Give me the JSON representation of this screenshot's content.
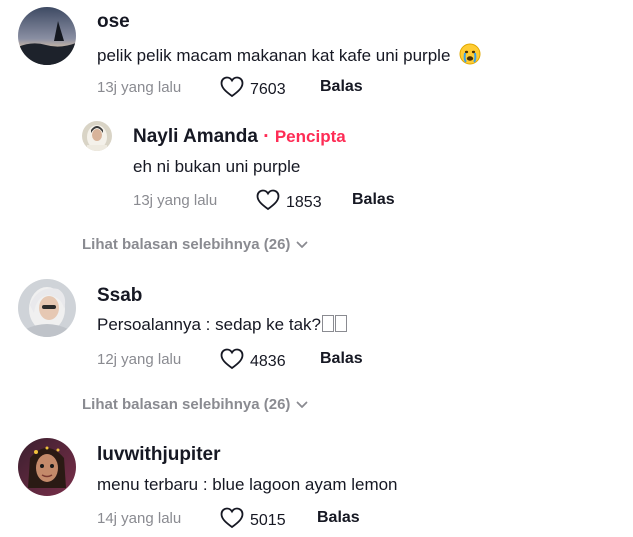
{
  "comments": [
    {
      "username": "ose",
      "text": "pelik pelik macam makanan kat kafe uni purple",
      "emoji_icon": "crying-face-emoji-icon",
      "time": "13j yang lalu",
      "likes": "7603",
      "reply_label": "Balas",
      "reply": {
        "username": "Nayli Amanda",
        "separator": "·",
        "creator_label": "Pencipta",
        "text": "eh ni bukan uni purple",
        "time": "13j yang lalu",
        "likes": "1853",
        "reply_label": "Balas"
      },
      "more_replies": "Lihat balasan selebihnya (26)"
    },
    {
      "username": "Ssab",
      "text": "Persoalannya : sedap ke tak?",
      "time": "12j yang lalu",
      "likes": "4836",
      "reply_label": "Balas",
      "more_replies": "Lihat balasan selebihnya (26)"
    },
    {
      "username": "luvwithjupiter",
      "text": "menu terbaru : blue lagoon ayam lemon",
      "time": "14j yang lalu",
      "likes": "5015",
      "reply_label": "Balas"
    }
  ],
  "colors": {
    "accent": "#fe2c55",
    "muted_text": "#8a8b91",
    "primary_text": "#161823"
  }
}
